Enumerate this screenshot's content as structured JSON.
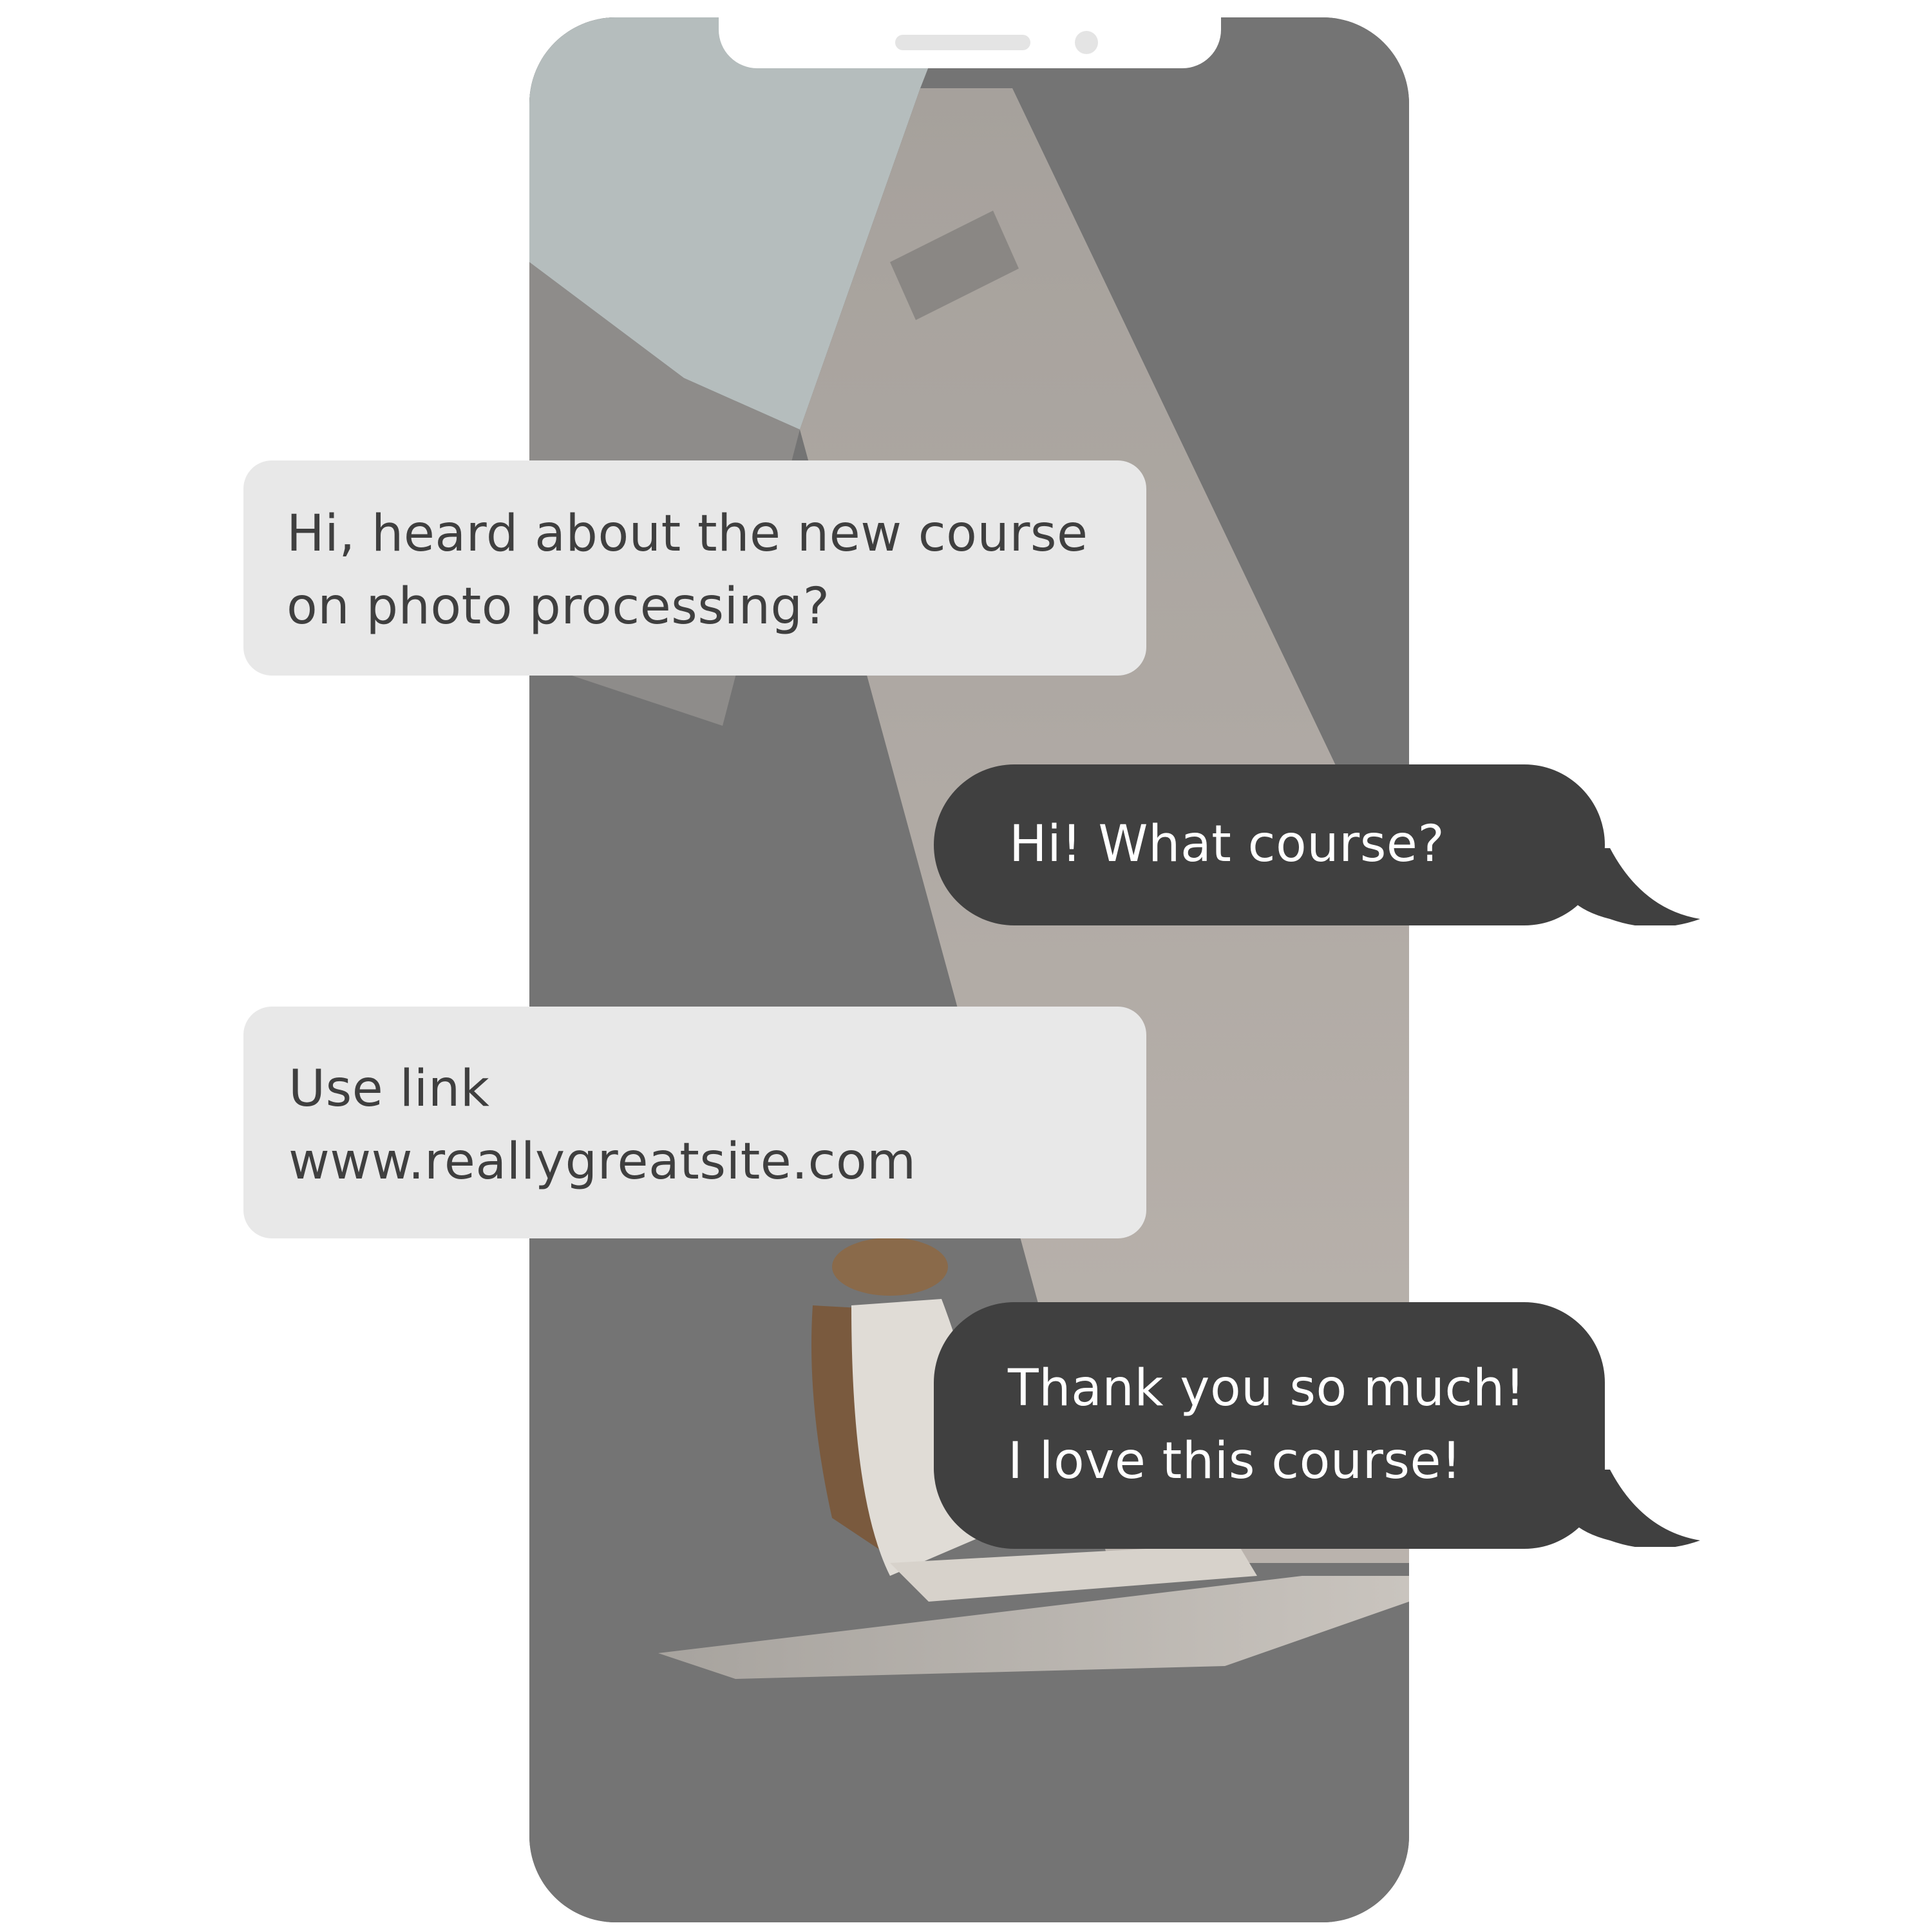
{
  "device": {
    "frame_color": "#747474",
    "bubble_incoming_color": "#e8e8e8",
    "bubble_outgoing_color": "#404040"
  },
  "messages": [
    {
      "direction": "incoming",
      "lines": [
        "Hi, heard about the new course",
        "on photo processing?"
      ]
    },
    {
      "direction": "outgoing",
      "lines": [
        "Hi! What course?"
      ]
    },
    {
      "direction": "incoming",
      "lines": [
        "Use link",
        "www.reallygreatsite.com"
      ]
    },
    {
      "direction": "outgoing",
      "lines": [
        "Thank you so much!",
        "I love this course!"
      ]
    }
  ]
}
